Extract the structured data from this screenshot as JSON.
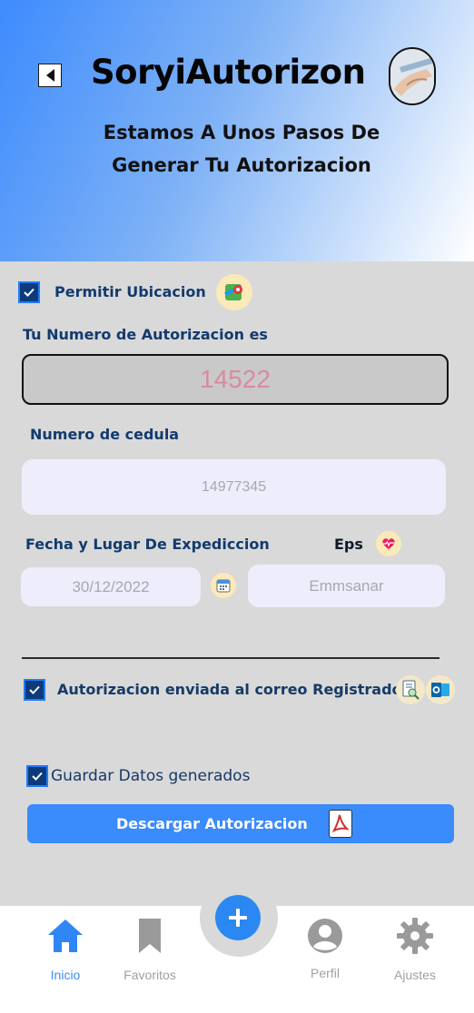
{
  "header": {
    "app_title": "SoryiAutorizon",
    "subtitle_line1": "Estamos A Unos Pasos De",
    "subtitle_line2": "Generar Tu Autorizacion"
  },
  "location": {
    "label": "Permitir Ubicacion",
    "checked": true,
    "icon": "map-pin-icon"
  },
  "authorization": {
    "label": "Tu Numero de Autorizacion es",
    "number": "14522"
  },
  "cedula": {
    "label": "Numero de  cedula",
    "value": "14977345"
  },
  "expedition": {
    "label": "Fecha y Lugar De Expediccion",
    "date_value": "30/12/2022",
    "icon": "calendar-icon"
  },
  "eps": {
    "label": "Eps",
    "value": "Emmsanar",
    "icon": "heart-icon"
  },
  "email_sent": {
    "label": "Autorizacion enviada al correo Registrado",
    "checked": true,
    "icons": [
      "document-search-icon",
      "outlook-icon"
    ]
  },
  "save_data": {
    "label": "Guardar Datos  generados",
    "checked": true
  },
  "download": {
    "label": "Descargar Autorizacion",
    "icon": "pdf-icon"
  },
  "bottom_nav": {
    "items": [
      {
        "label": "Inicio",
        "icon": "home-icon",
        "active": true
      },
      {
        "label": "Favoritos",
        "icon": "bookmark-icon",
        "active": false
      },
      {
        "label": "Perfil",
        "icon": "user-icon",
        "active": false
      },
      {
        "label": "Ajustes",
        "icon": "gear-icon",
        "active": false
      }
    ],
    "fab_icon": "plus-icon"
  },
  "colors": {
    "accent": "#3a8bfb",
    "label_blue": "#123a6e",
    "active_nav": "#3e8cf8"
  }
}
